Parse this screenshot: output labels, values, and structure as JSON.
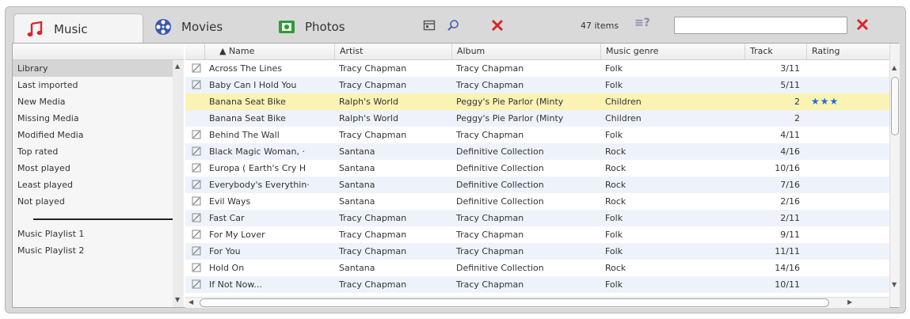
{
  "tabs": [
    {
      "label": "Music",
      "icon": "music-note-icon"
    },
    {
      "label": "Movies",
      "icon": "film-reel-icon"
    },
    {
      "label": "Photos",
      "icon": "photo-icon"
    }
  ],
  "toolbar": {
    "items_count": "47 items",
    "view_icon_text": "≡?",
    "search": {
      "value": "",
      "placeholder": ""
    },
    "icons": [
      "calendar-icon",
      "search-icon",
      "delete-icon",
      "clear-search-icon"
    ]
  },
  "sidebar": {
    "library_items": [
      "Library",
      "Last imported",
      "New Media",
      "Missing Media",
      "Modified Media",
      "Top rated",
      "Most played",
      "Least played",
      "Not played"
    ],
    "selected": "Library",
    "playlists": [
      "Music Playlist 1",
      "Music Playlist 2"
    ]
  },
  "table": {
    "columns": [
      "▲ Name",
      "Artist",
      "Album",
      "Music genre",
      "Track",
      "Rating"
    ],
    "rows": [
      {
        "icon": "edit-tag-icon",
        "name": "Across The Lines",
        "artist": "Tracy Chapman",
        "album": "Tracy Chapman",
        "genre": "Folk",
        "track": "3/11",
        "rating": ""
      },
      {
        "icon": "edit-tag-icon",
        "name": "Baby Can I Hold You",
        "artist": "Tracy Chapman",
        "album": "Tracy Chapman",
        "genre": "Folk",
        "track": "5/11",
        "rating": ""
      },
      {
        "icon": "",
        "name": "Banana Seat Bike",
        "artist": "Ralph's World",
        "album": "Peggy's Pie Parlor (Minty",
        "genre": "Children",
        "track": "2",
        "rating": "★★★",
        "highlight": true
      },
      {
        "icon": "",
        "name": "Banana Seat Bike",
        "artist": "Ralph's World",
        "album": "Peggy's Pie Parlor (Minty",
        "genre": "Children",
        "track": "2",
        "rating": ""
      },
      {
        "icon": "edit-tag-icon",
        "name": "Behind The Wall",
        "artist": "Tracy Chapman",
        "album": "Tracy Chapman",
        "genre": "Folk",
        "track": "4/11",
        "rating": ""
      },
      {
        "icon": "edit-tag-icon",
        "name": "Black Magic Woman, ·",
        "artist": "Santana",
        "album": "Definitive Collection",
        "genre": "Rock",
        "track": "4/16",
        "rating": ""
      },
      {
        "icon": "edit-tag-icon",
        "name": "Europa ( Earth's Cry H",
        "artist": "Santana",
        "album": "Definitive Collection",
        "genre": "Rock",
        "track": "10/16",
        "rating": ""
      },
      {
        "icon": "edit-tag-icon",
        "name": "Everybody's Everythin·",
        "artist": "Santana",
        "album": "Definitive Collection",
        "genre": "Rock",
        "track": "7/16",
        "rating": ""
      },
      {
        "icon": "edit-tag-icon",
        "name": "Evil Ways",
        "artist": "Santana",
        "album": "Definitive Collection",
        "genre": "Rock",
        "track": "2/16",
        "rating": ""
      },
      {
        "icon": "edit-tag-icon",
        "name": "Fast Car",
        "artist": "Tracy Chapman",
        "album": "Tracy Chapman",
        "genre": "Folk",
        "track": "2/11",
        "rating": ""
      },
      {
        "icon": "edit-tag-icon",
        "name": "For My Lover",
        "artist": "Tracy Chapman",
        "album": "Tracy Chapman",
        "genre": "Folk",
        "track": "9/11",
        "rating": ""
      },
      {
        "icon": "edit-tag-icon",
        "name": "For You",
        "artist": "Tracy Chapman",
        "album": "Tracy Chapman",
        "genre": "Folk",
        "track": "11/11",
        "rating": ""
      },
      {
        "icon": "edit-tag-icon",
        "name": "Hold On",
        "artist": "Santana",
        "album": "Definitive Collection",
        "genre": "Rock",
        "track": "14/16",
        "rating": ""
      },
      {
        "icon": "edit-tag-icon",
        "name": "If Not Now...",
        "artist": "Tracy Chapman",
        "album": "Tracy Chapman",
        "genre": "Folk",
        "track": "10/11",
        "rating": ""
      }
    ]
  },
  "colors": {
    "accent_red": "#d8262b",
    "highlight_row": "#fbf3b3",
    "rating_star": "#1a6fd8",
    "alt_row": "#eef3fb"
  }
}
